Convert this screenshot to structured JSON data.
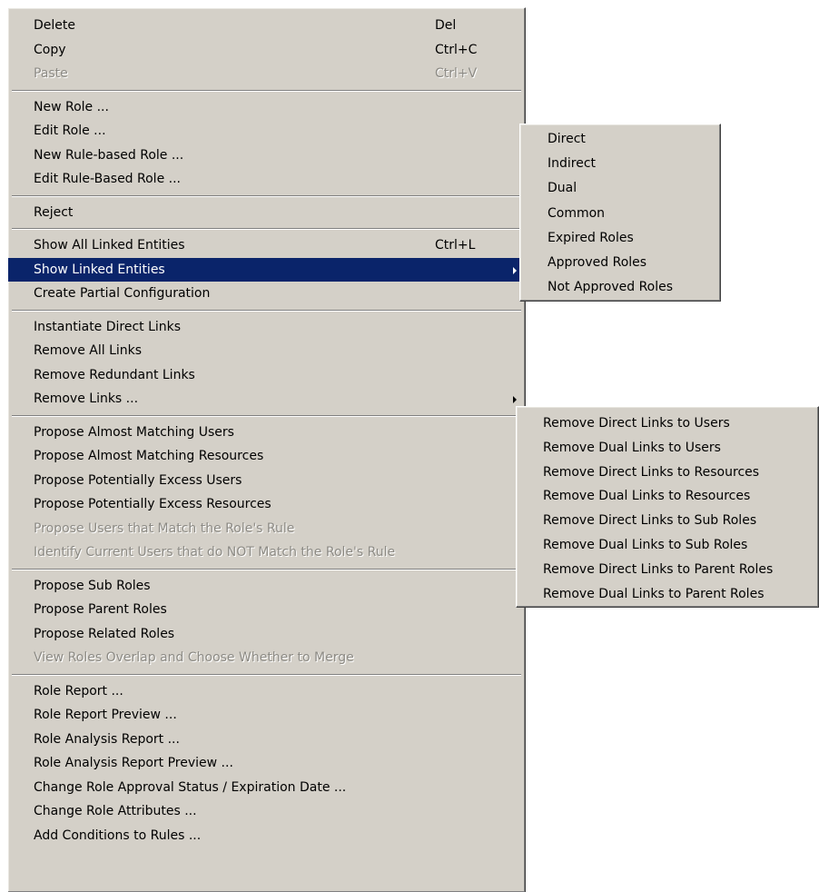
{
  "main_menu": {
    "groups": [
      [
        {
          "label": "Delete",
          "shortcut": "Del"
        },
        {
          "label": "Copy",
          "shortcut": "Ctrl+C"
        },
        {
          "label": "Paste",
          "shortcut": "Ctrl+V",
          "disabled": true
        }
      ],
      [
        {
          "label": "New Role ..."
        },
        {
          "label": "Edit Role ..."
        },
        {
          "label": "New Rule-based Role ..."
        },
        {
          "label": "Edit Rule-Based Role ..."
        }
      ],
      [
        {
          "label": "Reject"
        }
      ],
      [
        {
          "label": "Show All Linked Entities",
          "shortcut": "Ctrl+L"
        },
        {
          "label": "Show Linked Entities",
          "submenu": true,
          "highlighted": true
        },
        {
          "label": "Create Partial Configuration"
        }
      ],
      [
        {
          "label": "Instantiate Direct Links"
        },
        {
          "label": "Remove All Links"
        },
        {
          "label": "Remove Redundant Links"
        },
        {
          "label": "Remove Links ...",
          "submenu": true
        }
      ],
      [
        {
          "label": "Propose Almost Matching Users"
        },
        {
          "label": "Propose Almost Matching Resources"
        },
        {
          "label": "Propose Potentially Excess Users"
        },
        {
          "label": "Propose Potentially Excess Resources"
        },
        {
          "label": "Propose Users that Match the Role's Rule",
          "disabled": true
        },
        {
          "label": "Identify Current Users that do NOT Match the Role's Rule",
          "disabled": true
        }
      ],
      [
        {
          "label": "Propose Sub Roles"
        },
        {
          "label": "Propose Parent Roles"
        },
        {
          "label": "Propose Related Roles"
        },
        {
          "label": "View Roles Overlap and Choose Whether to Merge",
          "disabled": true
        }
      ],
      [
        {
          "label": "Role Report ..."
        },
        {
          "label": "Role Report Preview ..."
        },
        {
          "label": "Role Analysis Report ..."
        },
        {
          "label": "Role Analysis Report Preview ..."
        },
        {
          "label": "Change Role Approval Status / Expiration Date ..."
        },
        {
          "label": "Change Role Attributes ..."
        },
        {
          "label": "Add Conditions to Rules ..."
        }
      ]
    ]
  },
  "show_linked_submenu": {
    "items": [
      "Direct",
      "Indirect",
      "Dual",
      "Common",
      "Expired Roles",
      "Approved Roles",
      "Not Approved Roles"
    ]
  },
  "remove_links_submenu": {
    "items": [
      "Remove Direct Links to Users",
      "Remove Dual Links to Users",
      "Remove Direct Links to Resources",
      "Remove Dual Links to Resources",
      "Remove Direct Links to Sub Roles",
      "Remove Dual Links to Sub Roles",
      "Remove Direct Links to Parent Roles",
      "Remove Dual Links to Parent Roles"
    ]
  },
  "colors": {
    "menu_background": "#d4d0c8",
    "highlight": "#0a246a",
    "disabled_text": "#8c8a84"
  }
}
